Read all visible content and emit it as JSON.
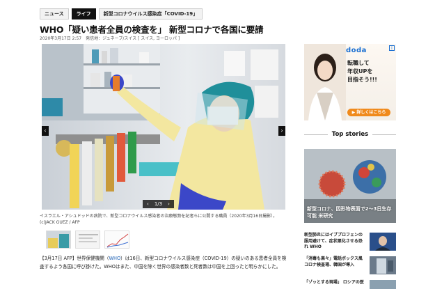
{
  "tags": [
    "ニュース",
    "ライフ",
    "新型コロナウイルス感染症「COVID-19」"
  ],
  "article": {
    "title": "WHO「疑い患者全員の検査を」 新型コロナで各国に要請",
    "meta": "2020年3月17日 2:57　発信地：ジュネーブ/スイス [ スイス, ヨーロッパ ]",
    "caption": "イスラエル・アシュドッドの病院で、新型コロナウイルス感染者の治療態勢を記者らに公開する職員（2020年3月16日撮影）。(c)JACK GUEZ / AFP",
    "gallery_counter": "1/3",
    "body_prefix": "【3月17日 AFP】世界保健機関（",
    "body_link": "WHO",
    "body_rest": "）は16日、新型コロナウイルス感染症（COVID-19）の疑いのある患者全員を検査するよう各国に呼び掛けた。WHOはまた、中国を除く世界の感染者数と死者数は中国を上回ったと明らかにした。"
  },
  "ad": {
    "logo": "doda",
    "text": "転職して\n年収UPを\n目指そう!!!",
    "button": "▶ 詳しくはこちら"
  },
  "sidebar": {
    "heading": "Top stories",
    "feature_text": "新型コロナ、因形物表面で2～3日生存可能 米研究",
    "stories": [
      {
        "text": "新型肺炎にはイブプロフェンの服用避けて、症状悪化させる恐れ WHO"
      },
      {
        "text": "「消毒も楽々」電話ボックス風コロナ検査場、韓国が導入"
      },
      {
        "text": "「ゾッとする現場」 ロシアの医"
      }
    ]
  },
  "colors": {
    "link": "#1a5fb4",
    "ad_button": "#f08a1c",
    "doda_blue": "#1a6fd1"
  }
}
